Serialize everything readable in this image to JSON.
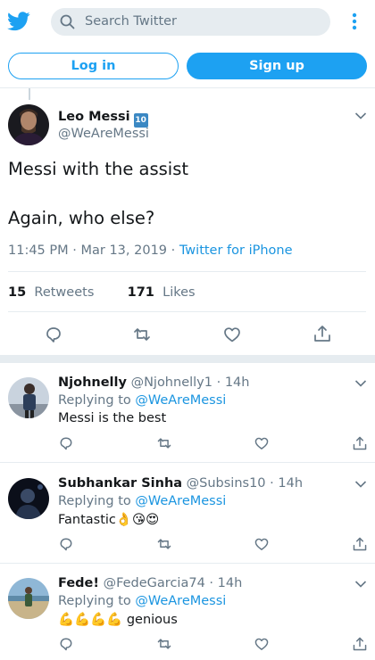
{
  "colors": {
    "accent": "#1da1f2",
    "link": "#1b95e0",
    "muted": "#657786",
    "border": "#e6ecf0"
  },
  "header": {
    "logo_icon": "twitter-bird-icon",
    "search_placeholder": "Search Twitter",
    "more_icon": "vertical-dots-icon"
  },
  "auth": {
    "login_label": "Log in",
    "signup_label": "Sign up"
  },
  "tweet": {
    "name": "Leo Messi",
    "badge": "10",
    "handle": "@WeAreMessi",
    "text_line1": "Messi with the assist",
    "text_line2": "Again, who else?",
    "timestamp": "11:45 PM · Mar 13, 2019 · ",
    "source": "Twitter for iPhone",
    "retweets_count": "15",
    "retweets_label": "Retweets",
    "likes_count": "171",
    "likes_label": "Likes"
  },
  "replies": [
    {
      "name": "Njohnelly",
      "handle": "@Njohnelly1",
      "time": "14h",
      "replying_prefix": "Replying to ",
      "replying_to": "@WeAreMessi",
      "text": "Messi is the best"
    },
    {
      "name": "Subhankar Sinha",
      "handle": "@Subsins10",
      "time": "14h",
      "replying_prefix": "Replying to ",
      "replying_to": "@WeAreMessi",
      "text": "Fantastic👌😘😍"
    },
    {
      "name": "Fede!",
      "handle": "@FedeGarcia74",
      "time": "14h",
      "replying_prefix": "Replying to ",
      "replying_to": "@WeAreMessi",
      "text": "💪💪💪💪 genious"
    }
  ]
}
